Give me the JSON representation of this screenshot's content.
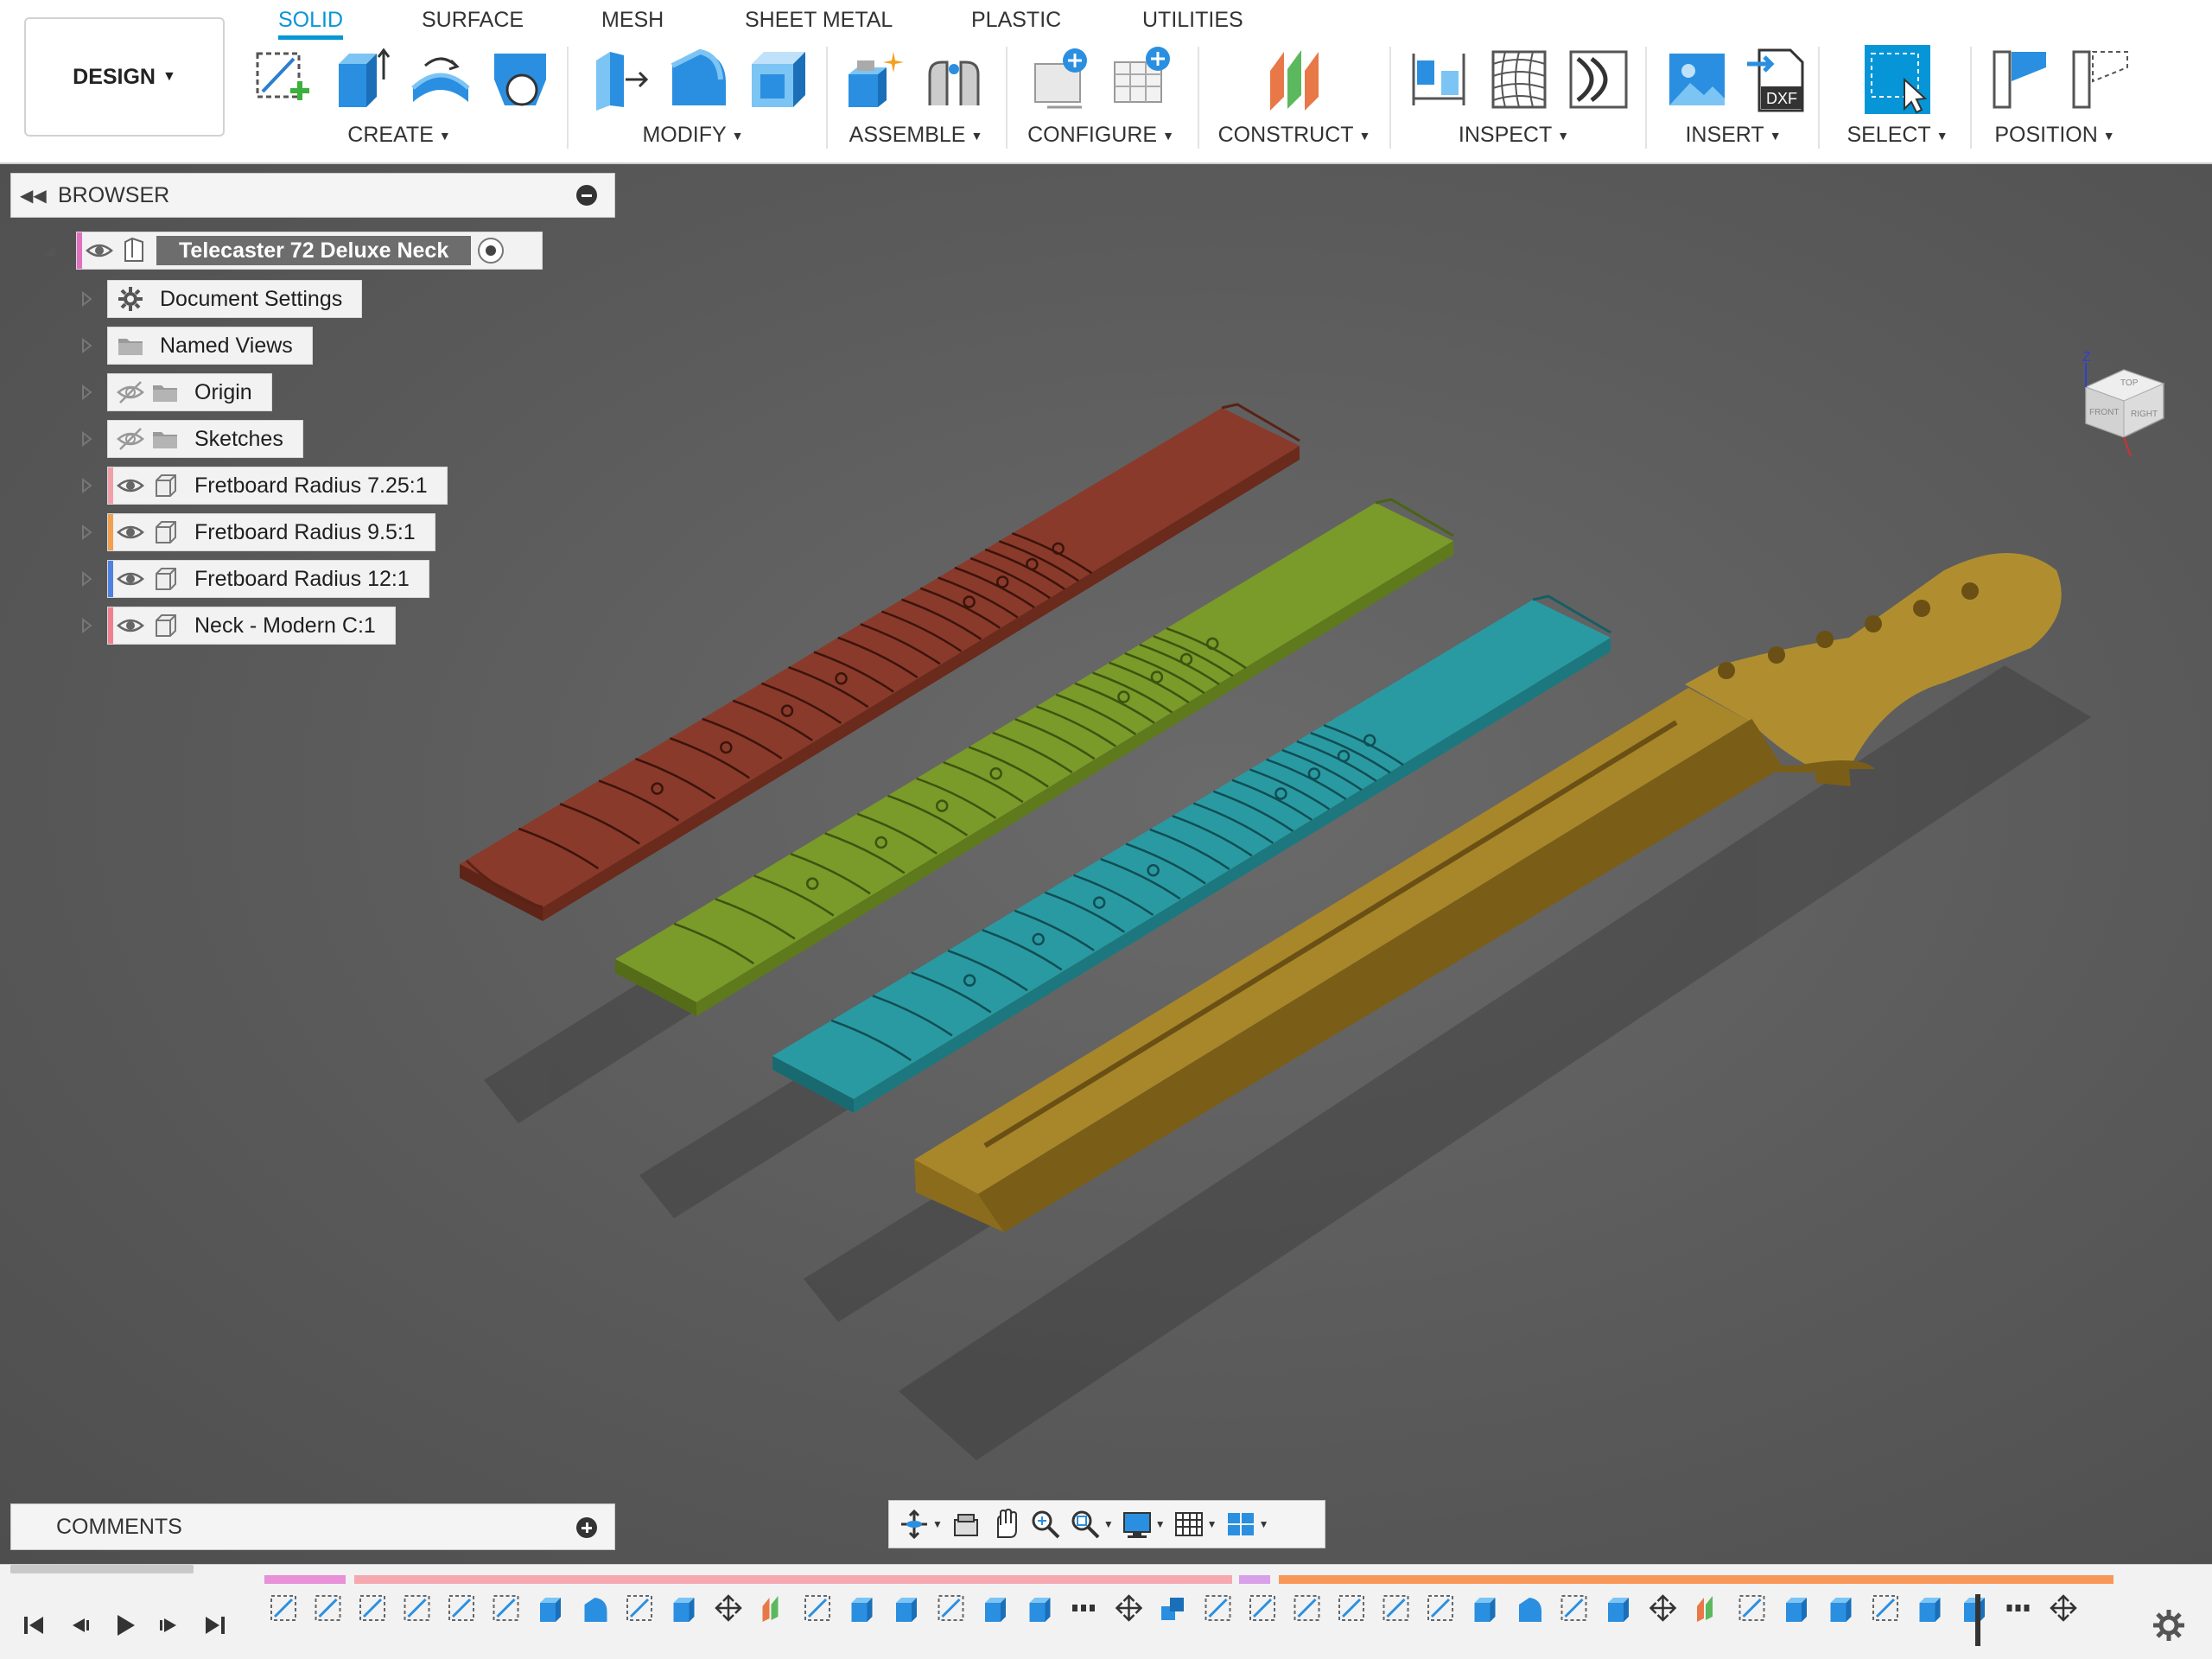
{
  "toolbar": {
    "workspace_button": "DESIGN",
    "tabs": [
      {
        "label": "SOLID",
        "active": true
      },
      {
        "label": "SURFACE",
        "active": false
      },
      {
        "label": "MESH",
        "active": false
      },
      {
        "label": "SHEET METAL",
        "active": false
      },
      {
        "label": "PLASTIC",
        "active": false
      },
      {
        "label": "UTILITIES",
        "active": false
      }
    ],
    "groups": [
      {
        "label": "CREATE",
        "tools": [
          "create-sketch-icon",
          "extrude-icon",
          "revolve-icon",
          "hole-icon"
        ]
      },
      {
        "label": "MODIFY",
        "tools": [
          "press-pull-icon",
          "fillet-icon",
          "shell-icon"
        ]
      },
      {
        "label": "ASSEMBLE",
        "tools": [
          "new-component-icon",
          "joint-icon"
        ]
      },
      {
        "label": "CONFIGURE",
        "tools": [
          "configure-icon",
          "configuration-table-icon"
        ]
      },
      {
        "label": "CONSTRUCT",
        "tools": [
          "midplane-icon"
        ]
      },
      {
        "label": "INSPECT",
        "tools": [
          "measure-icon",
          "zebra-analysis-icon",
          "curvature-icon"
        ]
      },
      {
        "label": "INSERT",
        "tools": [
          "insert-canvas-icon",
          "insert-dxf-icon"
        ]
      },
      {
        "label": "SELECT",
        "tools": [
          "select-icon"
        ]
      },
      {
        "label": "POSITION",
        "tools": [
          "capture-position-icon",
          "revert-position-icon"
        ]
      }
    ],
    "dxf_text": "DXF",
    "accent_color": "#0696d7"
  },
  "browser": {
    "title": "BROWSER",
    "root": {
      "label": "Telecaster 72 Deluxe Neck",
      "icon": "document-icon"
    },
    "items": [
      {
        "label": "Document Settings",
        "icon": "gear-icon",
        "visibility": "none",
        "color": ""
      },
      {
        "label": "Named Views",
        "icon": "folder-icon",
        "visibility": "none",
        "color": ""
      },
      {
        "label": "Origin",
        "icon": "folder-icon",
        "visibility": "hidden",
        "color": ""
      },
      {
        "label": "Sketches",
        "icon": "folder-icon",
        "visibility": "hidden",
        "color": ""
      },
      {
        "label": "Fretboard Radius 7.25:1",
        "icon": "component-icon",
        "visibility": "visible",
        "color": "#f0a0a8"
      },
      {
        "label": "Fretboard Radius 9.5:1",
        "icon": "component-icon",
        "visibility": "visible",
        "color": "#f0a050"
      },
      {
        "label": "Fretboard Radius 12:1",
        "icon": "component-icon",
        "visibility": "visible",
        "color": "#5080e0"
      },
      {
        "label": "Neck - Modern C:1",
        "icon": "component-icon",
        "visibility": "visible",
        "color": "#f08090"
      }
    ]
  },
  "viewcube": {
    "faces": [
      "TOP",
      "FRONT",
      "RIGHT"
    ],
    "axes": [
      "Z",
      "X"
    ]
  },
  "comments": {
    "title": "COMMENTS"
  },
  "scene": {
    "models": [
      {
        "name": "Fretboard Radius 7.25:1",
        "color": "#8a3a2a"
      },
      {
        "name": "Fretboard Radius 9.5:1",
        "color": "#7a9a2a"
      },
      {
        "name": "Fretboard Radius 12:1",
        "color": "#2a9aa2"
      },
      {
        "name": "Neck - Modern C:1",
        "color": "#a8862a"
      }
    ]
  },
  "navbar": {
    "tools": [
      "orbit-icon",
      "look-at-icon",
      "pan-icon",
      "zoom-icon",
      "fit-icon",
      "display-settings-icon",
      "grid-icon",
      "viewports-icon"
    ]
  },
  "timeline": {
    "controls": [
      "go-to-start-icon",
      "step-back-icon",
      "play-icon",
      "step-forward-icon",
      "go-to-end-icon"
    ],
    "segment_colors": [
      "#e890d8",
      "#f6a8b0",
      "#d8a0e8",
      "#f89858"
    ]
  }
}
